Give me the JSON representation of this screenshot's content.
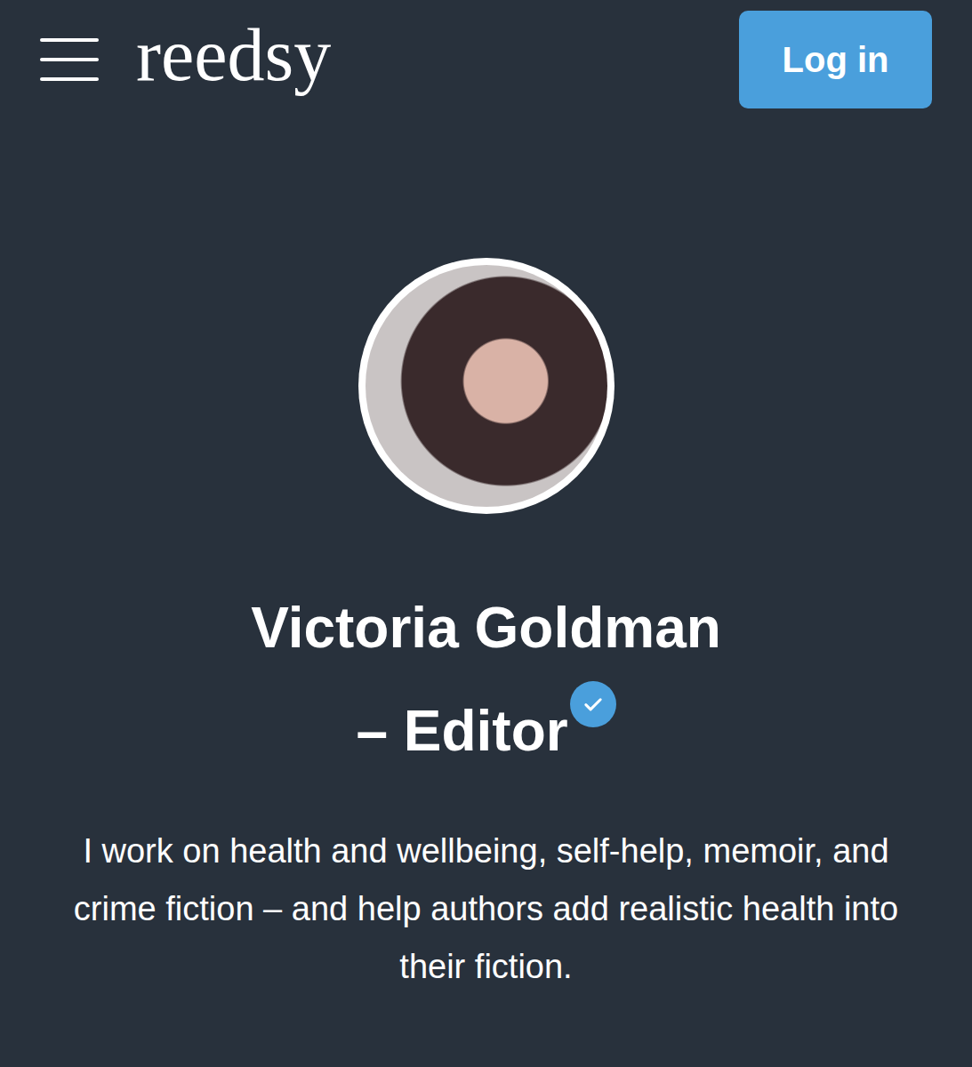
{
  "header": {
    "logo": "reedsy",
    "login_button": "Log in"
  },
  "profile": {
    "name": "Victoria Goldman",
    "role": "– Editor",
    "verified": true,
    "bio": "I work on health and wellbeing, self-help, memoir, and crime fiction – and help authors add realistic health into their fiction."
  }
}
